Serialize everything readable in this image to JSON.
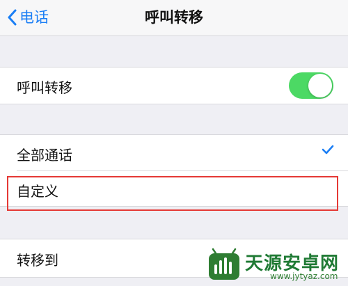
{
  "nav": {
    "back_label": "电话",
    "title": "呼叫转移"
  },
  "call_forwarding": {
    "label": "呼叫转移",
    "toggle_on": true,
    "toggle_color": "#4cd964"
  },
  "options": {
    "items": [
      {
        "label": "全部通话",
        "checked": true
      },
      {
        "label": "自定义",
        "checked": false
      }
    ],
    "check_color": "#1a7ef5",
    "highlight_color": "#e53935"
  },
  "forward_to": {
    "label": "转移到"
  },
  "watermark": {
    "name": "天源安卓网",
    "url": "www.jytyaz.com"
  },
  "colors": {
    "accent": "#1a7ef5",
    "background": "#efeff4"
  }
}
